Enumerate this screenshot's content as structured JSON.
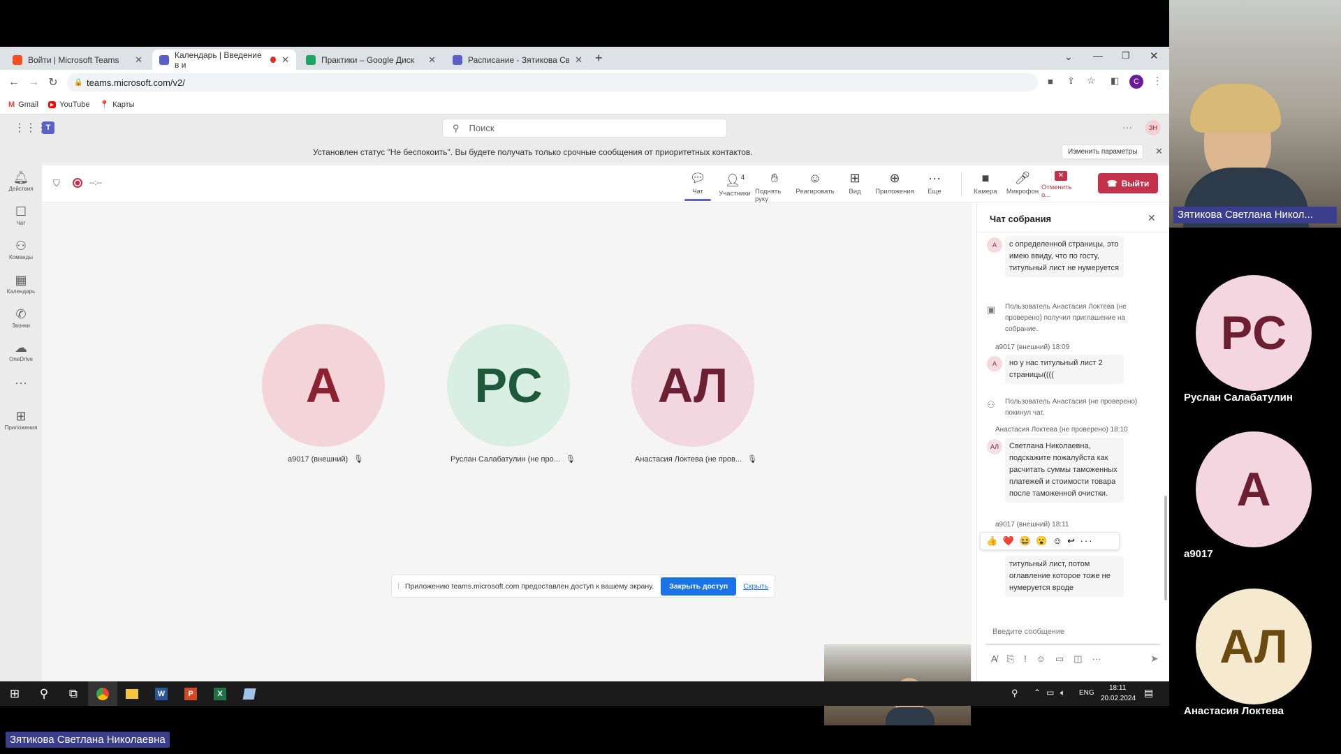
{
  "tabs": [
    {
      "title": "Войти | Microsoft Teams",
      "fav": "#f25022"
    },
    {
      "title": "Календарь | Введение в и",
      "fav": "#5b5fc7"
    },
    {
      "title": "Практики – Google Диск",
      "fav": "#1fa463"
    },
    {
      "title": "Расписание - Зятикова Светла",
      "fav": "#5b5fc7"
    }
  ],
  "new_tab": "+",
  "url": "teams.microsoft.com/v2/",
  "bookmarks": [
    "Gmail",
    "YouTube",
    "Карты"
  ],
  "search_placeholder": "Поиск",
  "profile_initials": "ЗН",
  "browser_profile": "C",
  "notice": {
    "text": "Установлен статус \"Не беспокоить\". Вы будете получать только срочные сообщения от приоритетных контактов.",
    "button": "Изменить параметры"
  },
  "rail": [
    {
      "icon": "bell-icon",
      "glyph": "🔔",
      "label": "Действия"
    },
    {
      "icon": "chat-icon",
      "glyph": "💬",
      "label": "Чат"
    },
    {
      "icon": "teams-icon",
      "glyph": "👥",
      "label": "Команды"
    },
    {
      "icon": "calendar-icon",
      "glyph": "📅",
      "label": "Календарь"
    },
    {
      "icon": "phone-icon",
      "glyph": "📞",
      "label": "Звонки"
    },
    {
      "icon": "cloud-icon",
      "glyph": "☁",
      "label": "OneDrive"
    },
    {
      "icon": "more-icon",
      "glyph": "···",
      "label": ""
    },
    {
      "icon": "apps-icon",
      "glyph": "⊞",
      "label": "Приложения"
    }
  ],
  "timer": "--:--",
  "toolbar": {
    "chat": "Чат",
    "participants": "Участники",
    "participants_count": "4",
    "raise_hand": "Поднять руку",
    "react": "Реагировать",
    "view": "Вид",
    "apps": "Приложения",
    "more": "Еще",
    "camera": "Камера",
    "mic": "Микрофон",
    "share": "Отменить о...",
    "leave": "Выйти"
  },
  "participants": [
    {
      "initials": "А",
      "name": "a9017 (внешний)",
      "bg": "#f3d5d9",
      "fg": "#8a2232"
    },
    {
      "initials": "PC",
      "name": "Руслан Салабатулин (не про...",
      "bg": "#d9efe3",
      "fg": "#1e5a3a"
    },
    {
      "initials": "АЛ",
      "name": "Анастасия Локтева (не пров...",
      "bg": "#f2d7e0",
      "fg": "#6b2133"
    }
  ],
  "share_notice": {
    "text": "Приложению teams.microsoft.com предоставлен доступ к вашему экрану.",
    "stop": "Закрыть доступ",
    "hide": "Скрыть"
  },
  "chat": {
    "title": "Чат собрания",
    "msg1": "с определенной страницы, это имею ввиду, что по госту, титульный лист не нумеруется",
    "sys1": "Пользователь Анастасия Локтева (не проверено) получил приглашение на собрание.",
    "meta1": "a9017 (внешний)  18:09",
    "msg2": "но у нас титульный лист 2 страницы((((",
    "sys2": "Пользователь Анастасия (не проверено) покинул чат.",
    "meta2": "Анастасия Локтева (не проверено)  18:10",
    "msg3": "Светлана Николаевна, подскажите пожалуйста как расчитать суммы таможенных платежей и стоимости товара после таможенной очистки.",
    "meta3": "a9017 (внешний)  18:11",
    "msg4": "титульный лист, потом оглавление которое тоже не нумеруется вроде",
    "reactions": "👍 ❤️ 😆 😮 ☺ ↩ ···",
    "input_placeholder": "Введите сообщение",
    "av_a": "A",
    "av_al": "АЛ"
  },
  "taskbar": {
    "lang": "ENG",
    "time": "18:11",
    "date": "20.02.2024"
  },
  "speaker_name": "Зятикова Светлана Никол...",
  "bottom_name": "Зятикова Светлана Николаевна",
  "right_participants": [
    {
      "initials": "PC",
      "name": "Руслан Салабатулин",
      "bg": "#f3d6df",
      "fg": "#6b1f30"
    },
    {
      "initials": "A",
      "name": "a9017",
      "bg": "#f3d6df",
      "fg": "#6b1f30"
    },
    {
      "initials": "АЛ",
      "name": "Анастасия Локтева",
      "bg": "#f5ead0",
      "fg": "#6b4a12"
    }
  ]
}
